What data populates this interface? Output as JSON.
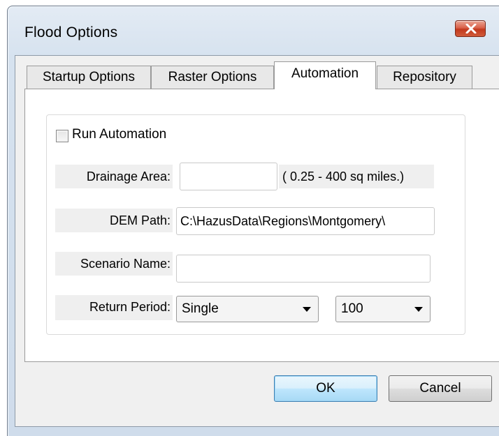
{
  "window": {
    "title": "Flood Options",
    "close_icon": "close-icon"
  },
  "tabs": [
    {
      "label": "Startup Options",
      "active": false
    },
    {
      "label": "Raster Options",
      "active": false
    },
    {
      "label": "Automation",
      "active": true
    },
    {
      "label": "Repository",
      "active": false
    }
  ],
  "automation": {
    "run_automation": {
      "label": "Run Automation",
      "checked": false
    },
    "drainage_area": {
      "label": "Drainage Area:",
      "value": "",
      "hint": "( 0.25 - 400 sq miles.)"
    },
    "dem_path": {
      "label": "DEM Path:",
      "value": "C:\\HazusData\\Regions\\Montgomery\\"
    },
    "scenario_name": {
      "label": "Scenario Name:",
      "value": ""
    },
    "return_period": {
      "label": "Return Period:",
      "type_value": "Single",
      "period_value": "100"
    }
  },
  "buttons": {
    "ok": "OK",
    "cancel": "Cancel"
  },
  "colors": {
    "close_button": "#c9452a",
    "default_button_border": "#3c7fb1",
    "window_frame": "#d6e2ef"
  }
}
